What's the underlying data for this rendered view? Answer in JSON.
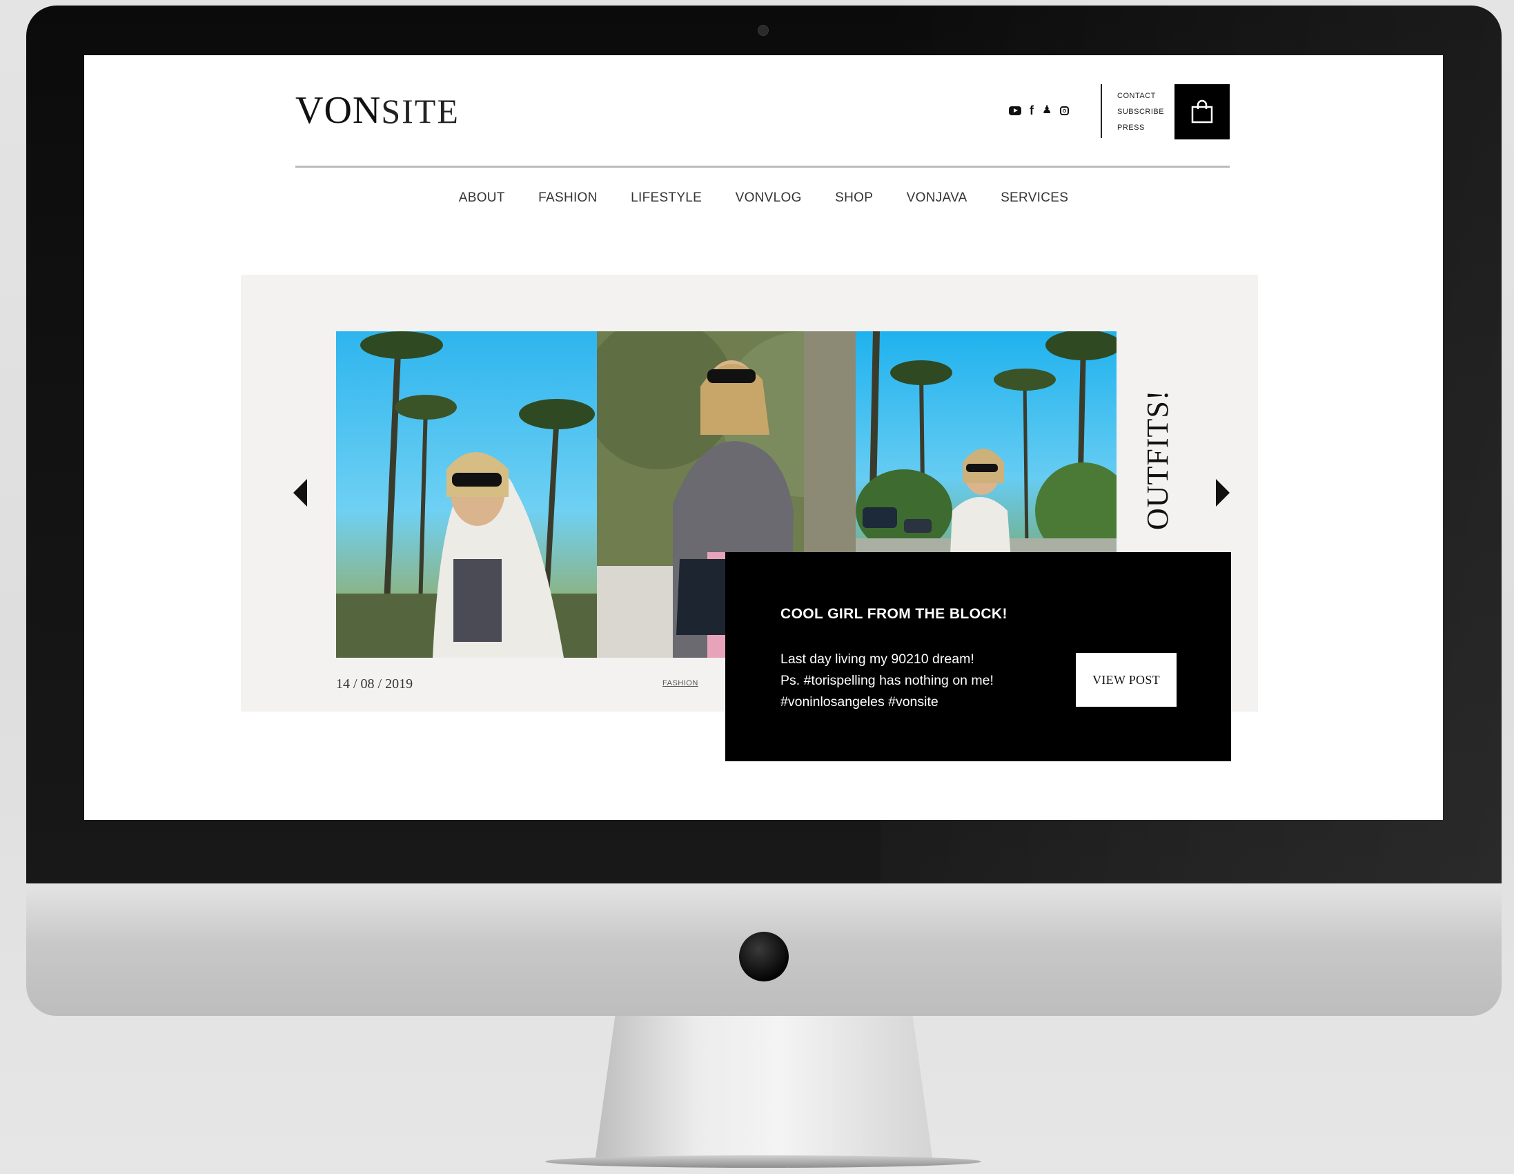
{
  "site": {
    "logo_part1": "VON",
    "logo_part2": "SITE"
  },
  "header": {
    "social_icons": [
      "youtube-icon",
      "facebook-icon",
      "snapchat-icon",
      "instagram-icon"
    ],
    "top_links": [
      "CONTACT",
      "SUBSCRIBE",
      "PRESS"
    ],
    "cart_icon": "shopping-bag-icon"
  },
  "nav": {
    "items": [
      "ABOUT",
      "FASHION",
      "LIFESTYLE",
      "VONVLOG",
      "SHOP",
      "VONJAVA",
      "SERVICES"
    ]
  },
  "hero": {
    "side_title": "OUTFITS!",
    "date": "14 / 08 / 2019",
    "category": "FASHION",
    "post_title": "COOL GIRL FROM THE BLOCK!",
    "post_lines": [
      "Last day living my 90210 dream!",
      "Ps. #torispelling has nothing on me!",
      "#voninlosangeles #vonsite"
    ],
    "cta": "VIEW POST",
    "prev_icon": "arrow-left-icon",
    "next_icon": "arrow-right-icon"
  },
  "colors": {
    "accent": "#000000",
    "hero_background": "#f3f2f1",
    "page_background": "#ffffff"
  }
}
